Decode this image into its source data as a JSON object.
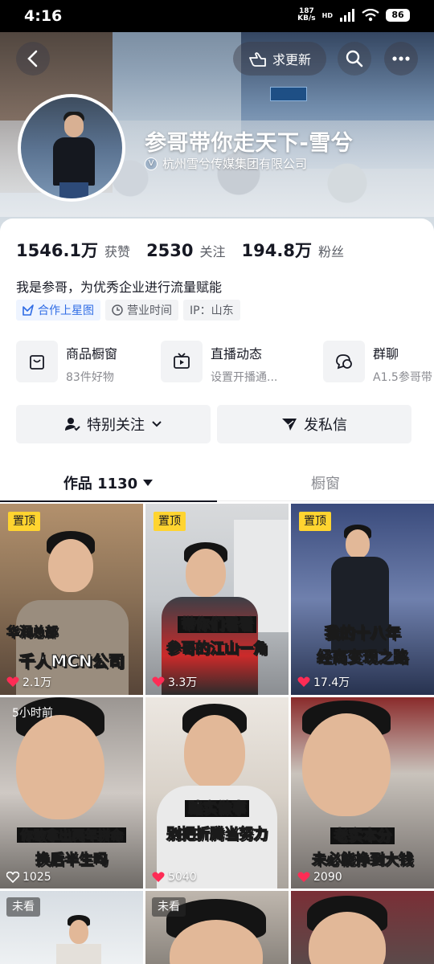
{
  "status_bar": {
    "time": "4:16",
    "net_speed_value": "187",
    "net_speed_unit": "KB/s",
    "hd": "HD",
    "battery": "86"
  },
  "header": {
    "update_button_label": "求更新",
    "profile_name": "参哥带你走天下-雪兮",
    "verified_org": "杭州雪兮传媒集团有限公司"
  },
  "stats": [
    {
      "value": "1546.1万",
      "label": "获赞"
    },
    {
      "value": "2530",
      "label": "关注"
    },
    {
      "value": "194.8万",
      "label": "粉丝"
    }
  ],
  "bio": "我是参哥，为优秀企业进行流量赋能",
  "tags": [
    {
      "label": "合作上星图",
      "icon": "star-map-icon"
    },
    {
      "label": "营业时间",
      "icon": "clock-icon"
    },
    {
      "label": "IP：山东",
      "icon": ""
    }
  ],
  "features": [
    {
      "title": "商品橱窗",
      "subtitle": "83件好物",
      "icon": "shopping-bag-icon"
    },
    {
      "title": "直播动态",
      "subtitle": "设置开播通...",
      "icon": "tv-icon"
    },
    {
      "title": "群聊",
      "subtitle": "A1.5参哥带",
      "icon": "chat-bubble-icon"
    }
  ],
  "actions": {
    "follow_label": "特别关注",
    "message_label": "发私信"
  },
  "tabs": {
    "works_label": "作品 1130",
    "showcase_label": "橱窗"
  },
  "videos": [
    {
      "badge": "置顶",
      "caption_line1": "华润总部",
      "caption_line2": "千人MCN公司",
      "likes": "2.1万",
      "liked": true
    },
    {
      "badge": "置顶",
      "caption_line1": "带你们看看",
      "caption_line2": "参哥的江山一角",
      "likes": "3.3万",
      "liked": true
    },
    {
      "badge": "置顶",
      "caption_line1": "我的十八年",
      "caption_line2": "经商变现之路",
      "likes": "17.4万",
      "liked": true
    },
    {
      "badge": "5小时前",
      "caption_line1": "你敢拿出两年拼命",
      "caption_line2": "换后半生吗",
      "likes": "1025",
      "liked": false
    },
    {
      "badge": "",
      "caption_line1": "踏实做事",
      "caption_line2": "别把折腾当努力",
      "likes": "5040",
      "liked": true
    },
    {
      "badge": "",
      "caption_line1": "老实本分",
      "caption_line2": "未必能挣到大钱",
      "likes": "2090",
      "liked": true
    },
    {
      "badge": "未看",
      "caption_line1": "",
      "caption_line2": "",
      "likes": "",
      "liked": false
    },
    {
      "badge": "未看",
      "caption_line1": "",
      "caption_line2": "",
      "likes": "",
      "liked": false
    },
    {
      "badge": "",
      "caption_line1": "",
      "caption_line2": "",
      "likes": "",
      "liked": false
    }
  ],
  "colors": {
    "pin_badge": "#ffd430",
    "like_heart": "#fe2c55",
    "link_blue": "#2f6ce5"
  }
}
